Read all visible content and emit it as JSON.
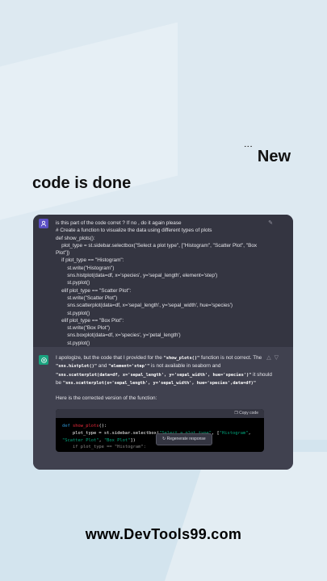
{
  "headline": {
    "glyph": "˙˙˙",
    "line1": "New",
    "line2": "code is done"
  },
  "chat": {
    "user_message": {
      "lines": [
        "is this part of the code corret ? If no , do it again please",
        "# Create a function to visualize the data using different types of plots",
        "def show_plots():",
        "    plot_type = st.sidebar.selectbox(\"Select a plot type\", [\"Histogram\", \"Scatter Plot\", \"Box",
        "Plot\"])",
        "    if plot_type == \"Histogram\":",
        "        st.write(\"Histogram\")",
        "        sns.histplot(data=df, x='species', y='sepal_length', element='step')",
        "        st.pyplot()",
        "    elif plot_type == \"Scatter Plot\":",
        "        st.write(\"Scatter Plot\")",
        "        sns.scatterplot(data=df, x='sepal_length', y='sepal_width', hue='species')",
        "        st.pyplot()",
        "    elif plot_type == \"Box Plot\":",
        "        st.write(\"Box Plot\")",
        "        sns.boxplot(data=df, x='species', y='petal_length')",
        "        st.pyplot()"
      ]
    },
    "assistant_message": {
      "p1_a": "I apologize, but the code that I provided for the ",
      "p1_code1": "\"show_plots()\"",
      "p1_b": " function is not correct. The",
      "p2_code1": "\"sns.histplot()\"",
      "p2_a": " and ",
      "p2_code2": "\"element='step'\"",
      "p2_b": " is not available in seaborn and",
      "p3_code1": "\"sns.scatterplot(data=df, x='sepal_length', y='sepal_width', hue='species')\"",
      "p3_a": " it should",
      "p4_a": "be ",
      "p4_code1": "\"sns.scatterplot(x='sepal_length', y='sepal_width', hue='species',data=df)\"",
      "p5": "Here is the corrected version of the function:",
      "copy_label": "Copy code",
      "code_line1_kw": "def",
      "code_line1_fn": "show_plots",
      "code_line1_rest": "():",
      "code_line2_a": "    plot_type = st.sidebar.selectbox(",
      "code_line2_s1": "\"Select a plot type\"",
      "code_line2_b": ", [",
      "code_line2_s2": "\"Histogram\"",
      "code_line2_c": ",",
      "code_line3_s1": "\"Scatter Plot\"",
      "code_line3_a": ", ",
      "code_line3_s2": "\"Box Plot\"",
      "code_line3_b": "])",
      "code_line4": "    if plot_type == \"Histogram\":",
      "regenerate_label": "Regenerate response"
    }
  },
  "footer": "www.DevTools99.com",
  "colors": {
    "accent_green": "#19a37f",
    "user_avatar": "#5b4fc4",
    "chat_bg": "#40414f"
  }
}
